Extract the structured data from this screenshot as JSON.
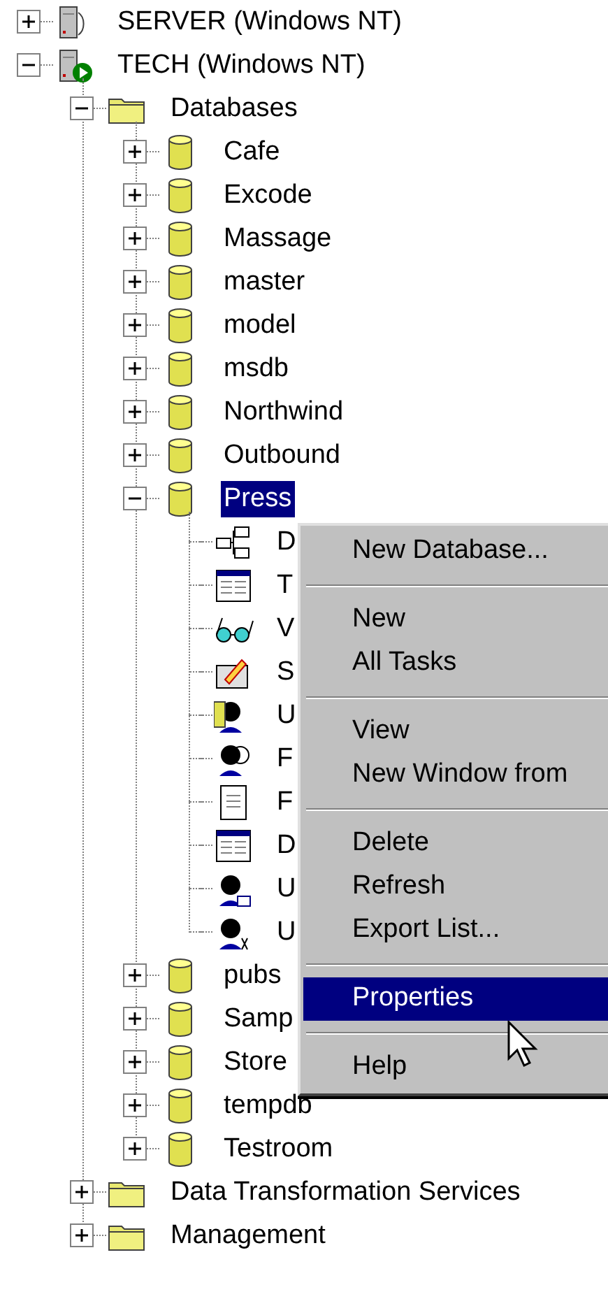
{
  "tree": [
    {
      "label": "SERVER (Windows NT)",
      "kind": "server",
      "expanded": false,
      "selected": false
    },
    {
      "label": "TECH (Windows NT)",
      "kind": "server-running",
      "expanded": true,
      "selected": false,
      "children": [
        {
          "label": "Databases",
          "kind": "folder",
          "expanded": true,
          "selected": false,
          "children": [
            {
              "label": "Cafe",
              "kind": "database",
              "expanded": false,
              "selected": false
            },
            {
              "label": "Excode",
              "kind": "database",
              "expanded": false,
              "selected": false
            },
            {
              "label": "Massage",
              "kind": "database",
              "expanded": false,
              "selected": false
            },
            {
              "label": "master",
              "kind": "database",
              "expanded": false,
              "selected": false
            },
            {
              "label": "model",
              "kind": "database",
              "expanded": false,
              "selected": false
            },
            {
              "label": "msdb",
              "kind": "database",
              "expanded": false,
              "selected": false
            },
            {
              "label": "Northwind",
              "kind": "database",
              "expanded": false,
              "selected": false
            },
            {
              "label": "Outbound",
              "kind": "database",
              "expanded": false,
              "selected": false
            },
            {
              "label": "Press",
              "kind": "database",
              "expanded": true,
              "selected": true,
              "children": [
                {
                  "label": "D",
                  "kind": "diagram",
                  "selected": false
                },
                {
                  "label": "T",
                  "kind": "table",
                  "selected": false
                },
                {
                  "label": "V",
                  "kind": "view",
                  "selected": false
                },
                {
                  "label": "S",
                  "kind": "procedure",
                  "selected": false
                },
                {
                  "label": "U",
                  "kind": "users",
                  "selected": false
                },
                {
                  "label": "F",
                  "kind": "roles",
                  "selected": false
                },
                {
                  "label": "F",
                  "kind": "rules",
                  "selected": false
                },
                {
                  "label": "D",
                  "kind": "defaults",
                  "selected": false
                },
                {
                  "label": "U",
                  "kind": "user-types",
                  "selected": false
                },
                {
                  "label": "U",
                  "kind": "user-functions",
                  "selected": false
                }
              ]
            },
            {
              "label": "pubs",
              "kind": "database",
              "expanded": false,
              "selected": false
            },
            {
              "label": "Samp",
              "kind": "database",
              "expanded": false,
              "selected": false
            },
            {
              "label": "Store",
              "kind": "database",
              "expanded": false,
              "selected": false
            },
            {
              "label": "tempdb",
              "kind": "database",
              "expanded": false,
              "selected": false
            },
            {
              "label": "Testroom",
              "kind": "database",
              "expanded": false,
              "selected": false
            }
          ]
        },
        {
          "label": "Data Transformation Services",
          "kind": "folder",
          "expanded": false,
          "selected": false
        },
        {
          "label": "Management",
          "kind": "folder",
          "expanded": false,
          "selected": false
        }
      ]
    }
  ],
  "context_menu": [
    {
      "kind": "item",
      "label": "New Database...",
      "selected": false
    },
    {
      "kind": "separator"
    },
    {
      "kind": "item",
      "label": "New",
      "selected": false
    },
    {
      "kind": "item",
      "label": "All Tasks",
      "selected": false
    },
    {
      "kind": "separator"
    },
    {
      "kind": "item",
      "label": "View",
      "selected": false
    },
    {
      "kind": "item",
      "label": "New Window from",
      "selected": false
    },
    {
      "kind": "separator"
    },
    {
      "kind": "item",
      "label": "Delete",
      "selected": false
    },
    {
      "kind": "item",
      "label": "Refresh",
      "selected": false
    },
    {
      "kind": "item",
      "label": "Export List...",
      "selected": false
    },
    {
      "kind": "separator"
    },
    {
      "kind": "item",
      "label": "Properties",
      "selected": true
    },
    {
      "kind": "separator"
    },
    {
      "kind": "item",
      "label": "Help",
      "selected": false
    }
  ]
}
